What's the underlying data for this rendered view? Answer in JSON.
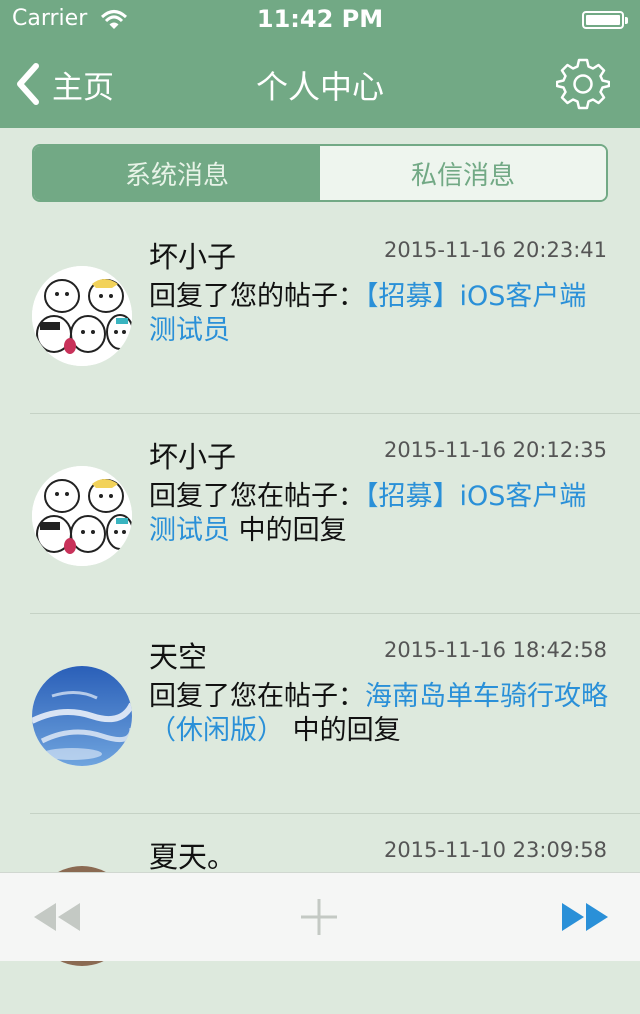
{
  "status": {
    "carrier": "Carrier",
    "time": "11:42 PM"
  },
  "nav": {
    "back_label": "主页",
    "title": "个人中心",
    "back_icon": "chevron-left-icon",
    "settings_icon": "gear-icon"
  },
  "tabs": [
    {
      "label": "系统消息",
      "selected": true
    },
    {
      "label": "私信消息",
      "selected": false
    }
  ],
  "messages": [
    {
      "name": "坏小子",
      "time": "2015-11-16 20:23:41",
      "prefix": "回复了您的帖子：",
      "link": "【招募】iOS客户端测试员",
      "suffix": "",
      "avatar": "cartoon-bears-avatar"
    },
    {
      "name": "坏小子",
      "time": "2015-11-16 20:12:35",
      "prefix": "回复了您在帖子：",
      "link": "【招募】iOS客户端测试员",
      "suffix": " 中的回复",
      "avatar": "cartoon-bears-avatar"
    },
    {
      "name": "天空",
      "time": "2015-11-16 18:42:58",
      "prefix": "回复了您在帖子：",
      "link": "海南岛单车骑行攻略（休闲版）",
      "suffix": " 中的回复",
      "avatar": "sky-clouds-avatar"
    },
    {
      "name": "夏天。",
      "time": "2015-11-10 23:09:58",
      "prefix": "",
      "link": "",
      "suffix": "",
      "avatar": "photo-avatar"
    }
  ],
  "toolbar": {
    "rewind_icon": "rewind-icon",
    "add_icon": "plus-icon",
    "fast_forward_icon": "fast-forward-icon"
  },
  "colors": {
    "nav": "#72a985",
    "background": "#dde9dd",
    "link": "#2a90d8",
    "toolbar_active": "#2a90d8",
    "toolbar_disabled": "#c4c9c4"
  }
}
